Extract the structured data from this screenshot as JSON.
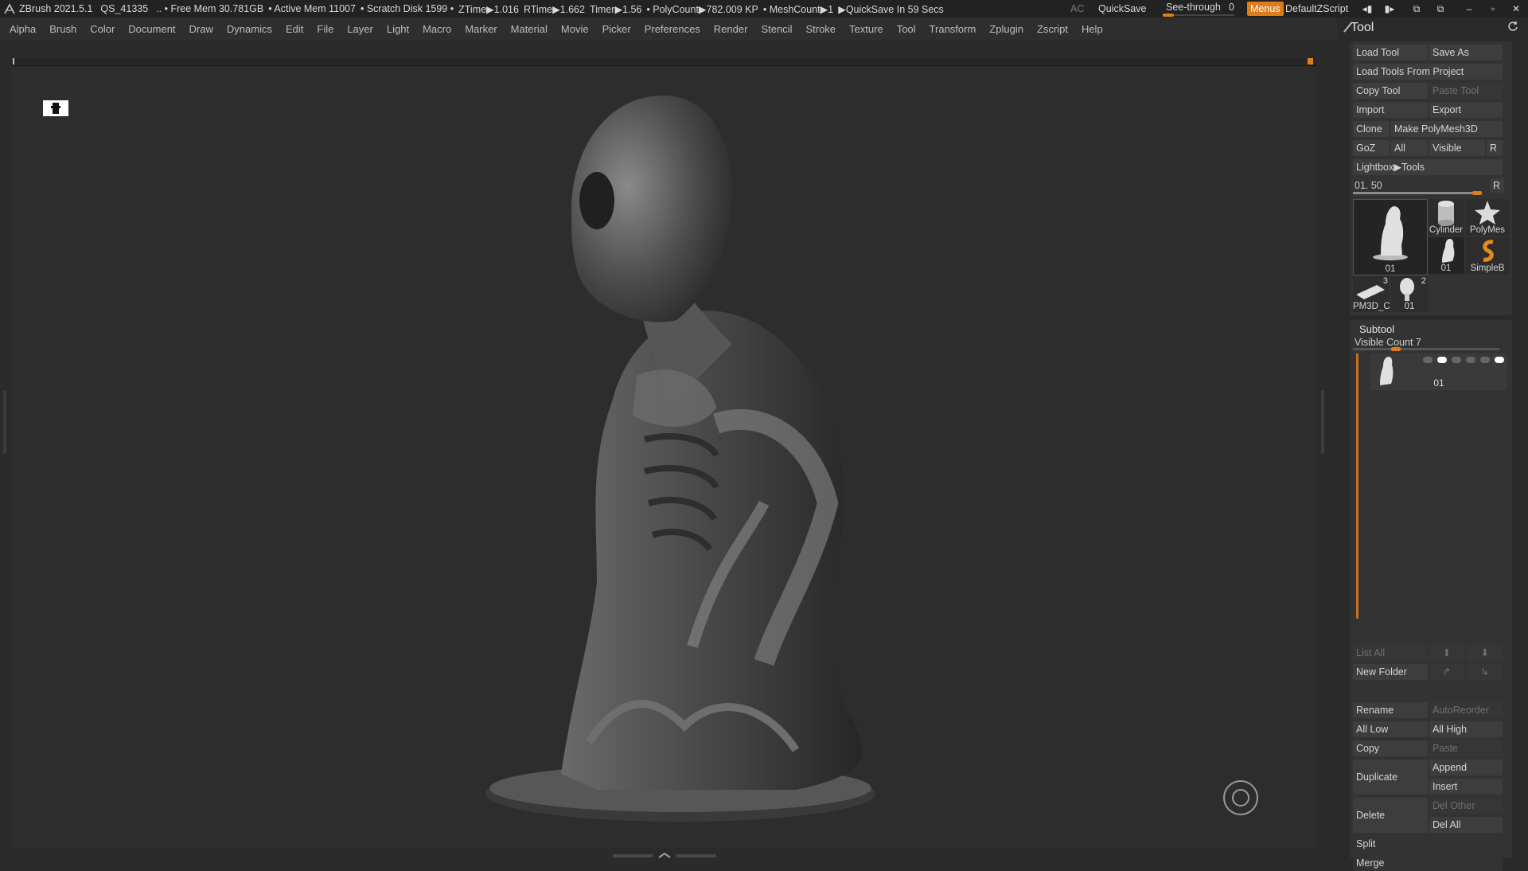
{
  "titlebar": {
    "app": "ZBrush 2021.5.1",
    "session": "QS_41335",
    "free_mem": ".. • Free Mem 30.781GB",
    "active_mem": "• Active Mem 11007",
    "scratch": "• Scratch Disk 1599 •",
    "ztime": "ZTime▶1.016",
    "rtime": "RTime▶1.662",
    "timer": "Timer▶1.56",
    "polycount": "• PolyCount▶782.009 KP",
    "meshcount": "• MeshCount▶1",
    "quicksave_in": "▶QuickSave In 59 Secs",
    "ac": "AC",
    "quicksave": "QuickSave",
    "see_through_label": "See-through",
    "see_through_value": "0",
    "menus": "Menus",
    "script": "DefaultZScript"
  },
  "menubar": {
    "items": [
      "Alpha",
      "Brush",
      "Color",
      "Document",
      "Draw",
      "Dynamics",
      "Edit",
      "File",
      "Layer",
      "Light",
      "Macro",
      "Marker",
      "Material",
      "Movie",
      "Picker",
      "Preferences",
      "Render",
      "Stencil",
      "Stroke",
      "Texture",
      "Tool",
      "Transform",
      "Zplugin",
      "Zscript",
      "Help"
    ]
  },
  "tool_panel": {
    "title": "Tool",
    "load_tool": "Load Tool",
    "save_as": "Save As",
    "load_from_project": "Load Tools From Project",
    "copy_tool": "Copy Tool",
    "paste_tool": "Paste Tool",
    "import": "Import",
    "export": "Export",
    "clone": "Clone",
    "make_polymesh": "Make PolyMesh3D",
    "goz": "GoZ",
    "all": "All",
    "visible": "Visible",
    "r": "R",
    "lightbox_tools": "Lightbox▶Tools",
    "slider_label": "01. 50",
    "slider_r": "R",
    "thumbnails": [
      {
        "caption": "01",
        "num": ""
      },
      {
        "caption": "Cylinder",
        "num": ""
      },
      {
        "caption": "PolyMes",
        "num": ""
      },
      {
        "caption": "01",
        "num": ""
      },
      {
        "caption": "SimpleB",
        "num": ""
      },
      {
        "caption": "PM3D_C",
        "num": "3"
      },
      {
        "caption": "01",
        "num": "2"
      }
    ]
  },
  "subtool": {
    "title": "Subtool",
    "visible_count": "Visible Count 7",
    "item_name": "01",
    "list_all": "List All",
    "new_folder": "New Folder",
    "rename": "Rename",
    "autoreorder": "AutoReorder",
    "all_low": "All Low",
    "all_high": "All High",
    "copy": "Copy",
    "paste": "Paste",
    "duplicate": "Duplicate",
    "append": "Append",
    "insert": "Insert",
    "delete": "Delete",
    "del_other": "Del Other",
    "del_all": "Del All",
    "split": "Split",
    "merge": "Merge"
  },
  "colors": {
    "accent": "#e07b1a",
    "background": "#2d2d2d",
    "panel": "#333333"
  }
}
